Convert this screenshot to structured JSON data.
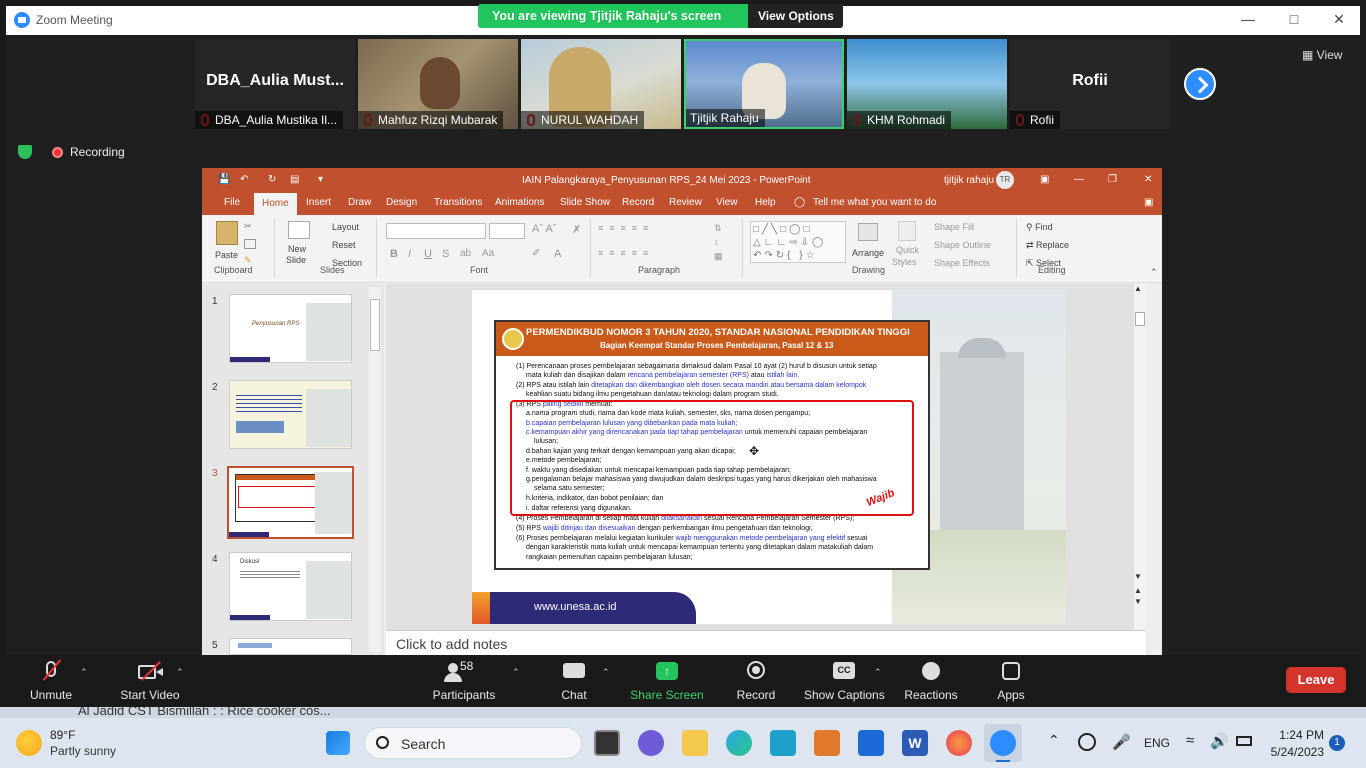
{
  "zoom": {
    "window_title": "Zoom Meeting",
    "banner": "You are viewing Tjitjik Rahaju's screen",
    "view_options": "View Options",
    "view_label": "View",
    "recording": "Recording",
    "participants": [
      {
        "display": "DBA_Aulia Must...",
        "name": "DBA_Aulia Mustika Il...",
        "video": false
      },
      {
        "display": "",
        "name": "Mahfuz Rizqi Mubarak",
        "video": true,
        "color": "#8a7a5c"
      },
      {
        "display": "",
        "name": "NURUL WAHDAH",
        "video": true,
        "color": "#9bb0c2"
      },
      {
        "display": "",
        "name": "Tjitjik Rahaju",
        "video": true,
        "color": "#4f7fc4"
      },
      {
        "display": "",
        "name": "KHM Rohmadi",
        "video": true,
        "color": "#3d8fc9"
      },
      {
        "display": "Rofii",
        "name": "Rofii",
        "video": false
      }
    ],
    "toolbar": {
      "unmute": "Unmute",
      "start_video": "Start Video",
      "participants": "Participants",
      "participants_count": "58",
      "chat": "Chat",
      "share_screen": "Share Screen",
      "record": "Record",
      "captions": "Show Captions",
      "reactions": "Reactions",
      "apps": "Apps",
      "leave": "Leave"
    }
  },
  "ppt": {
    "title": "IAIN Palangkaraya_Penyusunan RPS_24 Mei 2023  -  PowerPoint",
    "user": "tjitjik rahaju",
    "user_initials": "TR",
    "tabs": [
      "File",
      "Home",
      "Insert",
      "Draw",
      "Design",
      "Transitions",
      "Animations",
      "Slide Show",
      "Record",
      "Review",
      "View",
      "Help"
    ],
    "tell_me": "Tell me what you want to do",
    "groups": {
      "clipboard": "Clipboard",
      "slides": "Slides",
      "font": "Font",
      "paragraph": "Paragraph",
      "drawing": "Drawing",
      "editing": "Editing"
    },
    "ribbon": {
      "paste": "Paste",
      "new_slide": "New",
      "new_slide2": "Slide",
      "layout": "Layout",
      "reset": "Reset",
      "section": "Section",
      "arrange": "Arrange",
      "quick": "Quick",
      "styles": "Styles",
      "shape_fill": "Shape Fill",
      "shape_outline": "Shape Outline",
      "shape_effects": "Shape Effects",
      "find": "Find",
      "replace": "Replace",
      "select": "Select"
    },
    "thumbs": [
      {
        "n": "1",
        "title": "Penyusunan RPS"
      },
      {
        "n": "2",
        "title": ""
      },
      {
        "n": "3",
        "title": ""
      },
      {
        "n": "4",
        "title": "Diskusi"
      },
      {
        "n": "5",
        "title": ""
      }
    ],
    "slide": {
      "head1": "PERMENDIKBUD NOMOR 3 TAHUN 2020, STANDAR NASIONAL PENDIDIKAN TINGGI",
      "head2": "Bagian Keempat  Standar Proses Pembelajaran, Pasal 12 & 13",
      "l1a": "(1) Perencanaan proses pembelajaran sebagaimana dimaksud dalam Pasal 10 ayat (2) huruf b disusun untuk setiap",
      "l1b_pre": "mata kuliah dan disajikan dalam ",
      "l1b_blue": "rencana pembelajaran semester (RPS)",
      "l1b_mid": " atau ",
      "l1b_blue2": "istilah lain.",
      "l2a_pre": "(2) RPS atau istilah lain ",
      "l2a_blue": "ditetapkan dan dikembangkan oleh dosen secara mandiri atau bersama dalam kelompok",
      "l2b": "keahlian suatu bidang ilmu pengetahuan dan/atau teknologi dalam program studi.",
      "l3_pre": "(3) RPS ",
      "l3_blue": "paling sedikit",
      "l3_post": " memuat:",
      "a": "a.nama program studi, nama dan kode mata kuliah, semester, sks, nama dosen pengampu;",
      "b": "b.capaian pembelajaran lulusan yang dibebankan pada mata kuliah;",
      "c_blue": "c.kemampuan akhir yang direncanakan pada tiap tahap pembelajaran",
      "c_post": " untuk memenuhi capaian pembelajaran",
      "c2": "lulusan;",
      "d": "d.bahan kajian yang terkait dengan kemampuan yang akan dicapai;",
      "e": "e.metode pembelajaran;",
      "f": "f. waktu yang disediakan untuk mencapai kemampuan pada tiap tahap pembelajaran;",
      "g": "g.pengalaman belajar mahasiswa yang diwujudkan dalam deskripsi tugas yang harus dikerjakan oleh mahasiswa",
      "g2": "selama satu semester;",
      "h": "h.kriteria, indikator, dan bobot penilaian; dan",
      "i": "i. daftar referensi yang digunakan.",
      "l4_pre": "(4) Proses Pembelajaran di setiap mata kuliah ",
      "l4_blue": "dilaksanakan",
      "l4_post": " sesuai Rencana Pembelajaran Semester (RPS);",
      "l5_pre": "(5) RPS ",
      "l5_blue": "wajib ditinjau dan disesuaikan",
      "l5_post": " dengan perkembangan ilmu pengetahuan dan teknologi;",
      "l6_pre": "(6) Proses pembelajaran melalui kegiatan kurikuler ",
      "l6_blue": "wajib menggunakan metode pembelajaran yang efektif",
      "l6_post": " sesuai",
      "l6b": "dengan karakteristik mata kuliah untuk mencapai kemampuan tertentu yang ditetapkan dalam matakuliah dalam",
      "l6c": "rangkaian pemenuhan capaian pembelajaran lulusan;",
      "wajib": "Wajib",
      "website": "www.unesa.ac.id"
    },
    "notes": "Click to add notes"
  },
  "taskbar": {
    "behind_text": "Al Jadid CST   Bismillah : : Rice cooker cos...",
    "weather_temp": "89°F",
    "weather_desc": "Partly sunny",
    "search": "Search",
    "lang": "ENG",
    "time": "1:24 PM",
    "date": "5/24/2023",
    "notif": "1"
  }
}
